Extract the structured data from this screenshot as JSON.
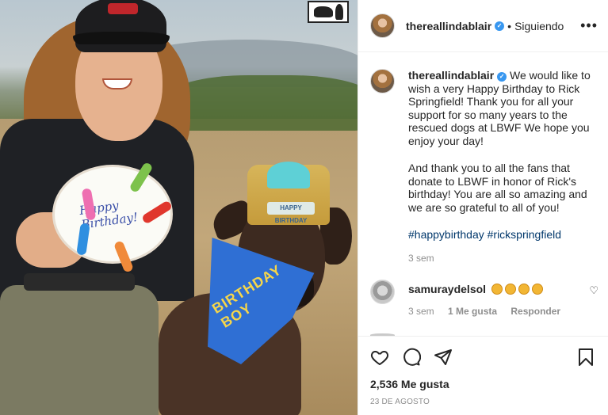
{
  "post": {
    "username": "thereallindablair",
    "follow_dot": "•",
    "follow_status": "Siguiendo",
    "more_icon": "more-horizontal-icon"
  },
  "photo": {
    "cake_text": "Happy Birthday!",
    "crown_label": "HAPPY BIRTHDAY",
    "bandana_text": "BIRTHDAY BOY"
  },
  "caption": {
    "username": "thereallindablair",
    "text_part1": "We would like to wish a very Happy Birthday to Rick Springfield! Thank you for all your support for so many years to the rescued dogs at LBWF We hope you enjoy your day!",
    "text_part2": "And thank you to all the fans that donate to LBWF in honor of Rick's birthday! You are all so amazing and we are so grateful to all of you!",
    "hashtags": "#happybirthday #rickspringfield",
    "time": "3 sem"
  },
  "comment": {
    "username": "samuraydelsol",
    "time": "3 sem",
    "likes": "1 Me gusta",
    "reply": "Responder"
  },
  "footer": {
    "likes": "2,536 Me gusta",
    "date": "23 DE AGOSTO"
  }
}
